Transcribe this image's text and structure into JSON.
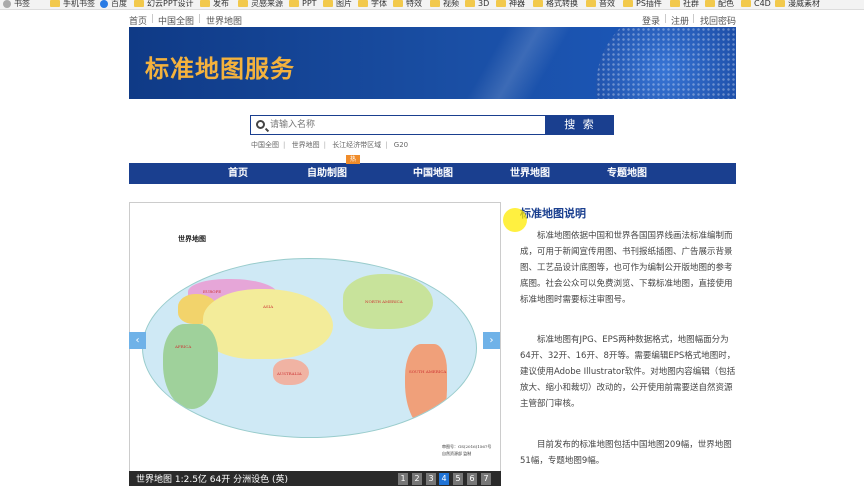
{
  "bookmarks": [
    {
      "label": "书签",
      "icon": "bookmark-star-icon"
    },
    {
      "label": "手机书签",
      "icon": "folder-icon"
    },
    {
      "label": "百度",
      "icon": "baidu-paw-icon"
    },
    {
      "label": "幻云PPT设计",
      "icon": "folder-icon"
    },
    {
      "label": "发布",
      "icon": "folder-icon"
    },
    {
      "label": "灵感来源",
      "icon": "folder-icon"
    },
    {
      "label": "PPT",
      "icon": "folder-icon"
    },
    {
      "label": "图片",
      "icon": "folder-icon"
    },
    {
      "label": "字体",
      "icon": "folder-icon"
    },
    {
      "label": "特效",
      "icon": "folder-icon"
    },
    {
      "label": "视频",
      "icon": "folder-icon"
    },
    {
      "label": "3D",
      "icon": "folder-icon"
    },
    {
      "label": "神器",
      "icon": "folder-icon"
    },
    {
      "label": "格式转换",
      "icon": "folder-icon"
    },
    {
      "label": "音效",
      "icon": "folder-icon"
    },
    {
      "label": "PS插件",
      "icon": "folder-icon"
    },
    {
      "label": "社群",
      "icon": "folder-icon"
    },
    {
      "label": "配色",
      "icon": "folder-icon"
    },
    {
      "label": "C4D",
      "icon": "folder-icon"
    },
    {
      "label": "漫威素材",
      "icon": "folder-icon"
    }
  ],
  "top_nav": {
    "left": [
      "首页",
      "中国全图",
      "世界地图"
    ],
    "right": [
      "登录",
      "注册",
      "找回密码"
    ]
  },
  "banner": {
    "title": "标准地图服务"
  },
  "search": {
    "placeholder": "请输入名称",
    "button_label": "搜 索",
    "quick_links": [
      "中国全图",
      "世界地图",
      "长江经济带区域",
      "G20"
    ]
  },
  "main_nav": {
    "items": [
      "首页",
      "自助制图",
      "中国地图",
      "世界地图",
      "专题地图"
    ],
    "hot_badge": "热"
  },
  "map_viewer": {
    "map_title": "世界地图",
    "labels": [
      "EUROPE",
      "ASIA",
      "AFRICA",
      "NORTH AMERICA",
      "SOUTH AMERICA",
      "AUSTRALIA"
    ],
    "stamp_line1": "审图号：GS(2016)1567号",
    "stamp_line2": "自然资源部 监制",
    "caption": "世界地图 1:2.5亿 64开 分洲设色 (英)",
    "pages": [
      "1",
      "2",
      "3",
      "4",
      "5",
      "6",
      "7"
    ],
    "active_page": "4",
    "prev_glyph": "‹",
    "next_glyph": "›"
  },
  "description": {
    "title": "标准地图说明",
    "paragraphs": [
      "标准地图依据中国和世界各国国界线画法标准编制而成，可用于新闻宣传用图、书刊报纸插图、广告展示背景图、工艺品设计底图等，也可作为编制公开版地图的参考底图。社会公众可以免费浏览、下载标准地图，直接使用标准地图时需要标注审图号。",
      "标准地图有JPG、EPS两种数据格式，地图幅面分为64开、32开、16开、8开等。需要编辑EPS格式地图时，建议使用Adobe Illustrator软件。对地图内容编辑（包括放大、缩小和裁切）改动的，公开使用前需要送自然资源主管部门审核。",
      "目前发布的标准地图包括中国地图209幅，世界地图51幅，专题地图9幅。"
    ]
  },
  "colors": {
    "brand_blue": "#1a3f8f",
    "banner_title": "#f4b23d",
    "active_page": "#1f73d6",
    "hot_badge": "#f08c2a"
  }
}
